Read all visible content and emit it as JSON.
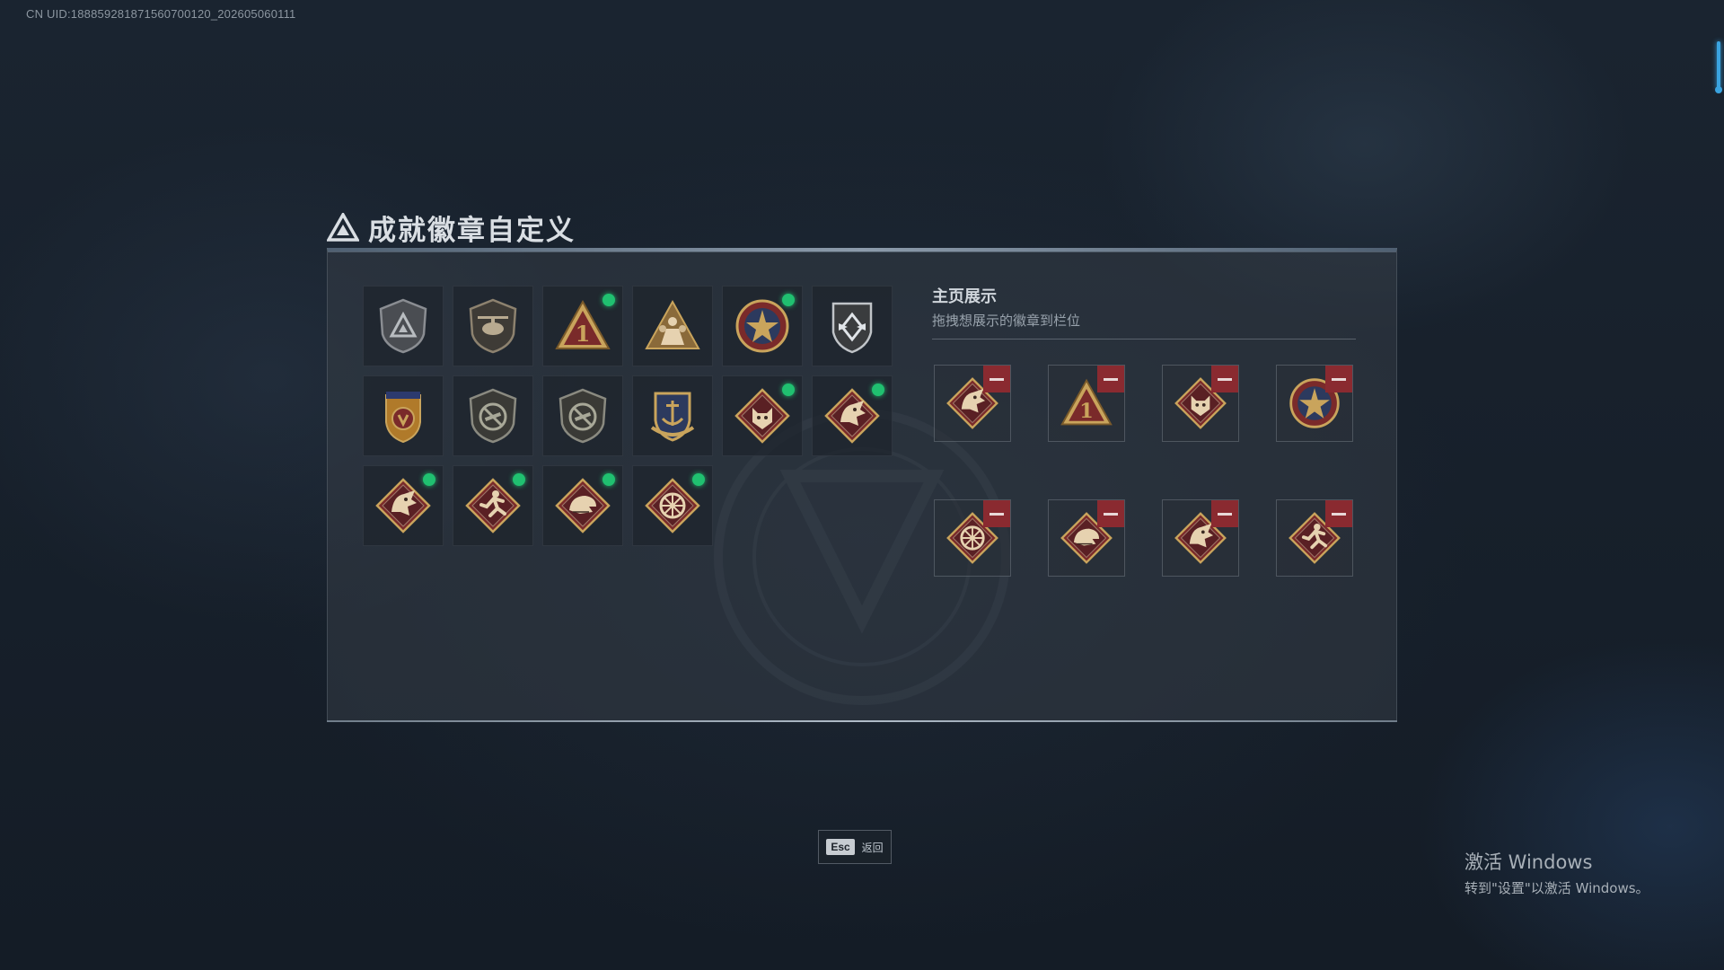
{
  "uid_text": "CN UID:188859281871560700120_202605060111",
  "panel": {
    "title": "成就徽章自定义",
    "title_icon": "delta-triangle-icon"
  },
  "badges": [
    {
      "icon": "triangle-shield-badge",
      "new": false
    },
    {
      "icon": "helicopter-shield-badge",
      "new": false
    },
    {
      "icon": "number-one-triangle-badge",
      "new": true
    },
    {
      "icon": "soldiers-triangle-badge",
      "new": false
    },
    {
      "icon": "star-medal-badge",
      "new": true
    },
    {
      "icon": "wing-shield-badge",
      "new": false
    },
    {
      "icon": "eagle-shield-medal-badge",
      "new": false
    },
    {
      "icon": "no-rifle-shield-badge",
      "new": false
    },
    {
      "icon": "no-pistol-shield-badge",
      "new": false
    },
    {
      "icon": "anchor-crest-badge",
      "new": false
    },
    {
      "icon": "wolf-diamond-badge",
      "new": true
    },
    {
      "icon": "dragon-diamond-badge",
      "new": true
    },
    {
      "icon": "dragon-diamond-badge",
      "new": true
    },
    {
      "icon": "runner-diamond-badge",
      "new": true
    },
    {
      "icon": "dinosaur-diamond-badge",
      "new": true
    },
    {
      "icon": "wheel-diamond-badge",
      "new": true
    }
  ],
  "showcase": {
    "title": "主页展示",
    "subtitle": "拖拽想展示的徽章到栏位",
    "slots": [
      {
        "icon": "dragon-diamond-badge"
      },
      {
        "icon": "number-one-triangle-badge"
      },
      {
        "icon": "wolf-diamond-badge"
      },
      {
        "icon": "star-medal-badge"
      },
      {
        "icon": "wheel-diamond-badge"
      },
      {
        "icon": "dinosaur-diamond-badge"
      },
      {
        "icon": "dragon-diamond-badge"
      },
      {
        "icon": "runner-diamond-badge"
      }
    ]
  },
  "esc": {
    "key": "Esc",
    "label": "返回"
  },
  "windows_activation": {
    "title": "激活 Windows",
    "subtitle": "转到\"设置\"以激活 Windows。"
  },
  "colors": {
    "new_dot": "#20c070",
    "remove_button": "#8a2a30",
    "scroll_accent": "#3aa3e0"
  }
}
